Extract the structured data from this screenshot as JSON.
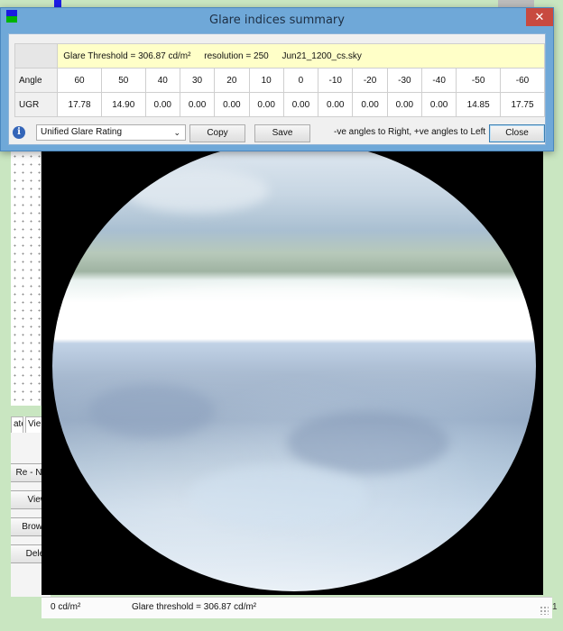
{
  "dialog": {
    "title": "Glare indices summary",
    "close_glyph": "✕",
    "info": {
      "threshold": "Glare Threshold = 306.87 cd/m²",
      "resolution": "resolution = 250",
      "sky": "Jun21_1200_cs.sky"
    },
    "table": {
      "row_headers": [
        "Angle",
        "UGR"
      ],
      "angles": [
        "60",
        "50",
        "40",
        "30",
        "20",
        "10",
        "0",
        "-10",
        "-20",
        "-30",
        "-40",
        "-50",
        "-60"
      ],
      "ugr": [
        "17.78",
        "14.90",
        "0.00",
        "0.00",
        "0.00",
        "0.00",
        "0.00",
        "0.00",
        "0.00",
        "0.00",
        "0.00",
        "14.85",
        "17.75"
      ]
    },
    "toolbar": {
      "info_glyph": "i",
      "rating_select": "Unified Glare Rating",
      "chevron_glyph": "⌄",
      "copy_label": "Copy",
      "save_label": "Save",
      "hint": "-ve angles to Right, +ve angles to Left",
      "close_label": "Close"
    }
  },
  "background": {
    "tabs": [
      "ate",
      "Vie"
    ],
    "buttons": [
      "Re - Na",
      "View",
      "Brows",
      "Delet"
    ],
    "status": {
      "left": "0 cd/m²",
      "threshold": "Glare threshold =  306.87 cd/m²"
    },
    "edge_text": "1"
  },
  "colors": {
    "titlebar": "#6fa8d8",
    "close_button": "#c84a40",
    "info_row": "#ffffc8",
    "app_background": "#c9e6c1"
  }
}
